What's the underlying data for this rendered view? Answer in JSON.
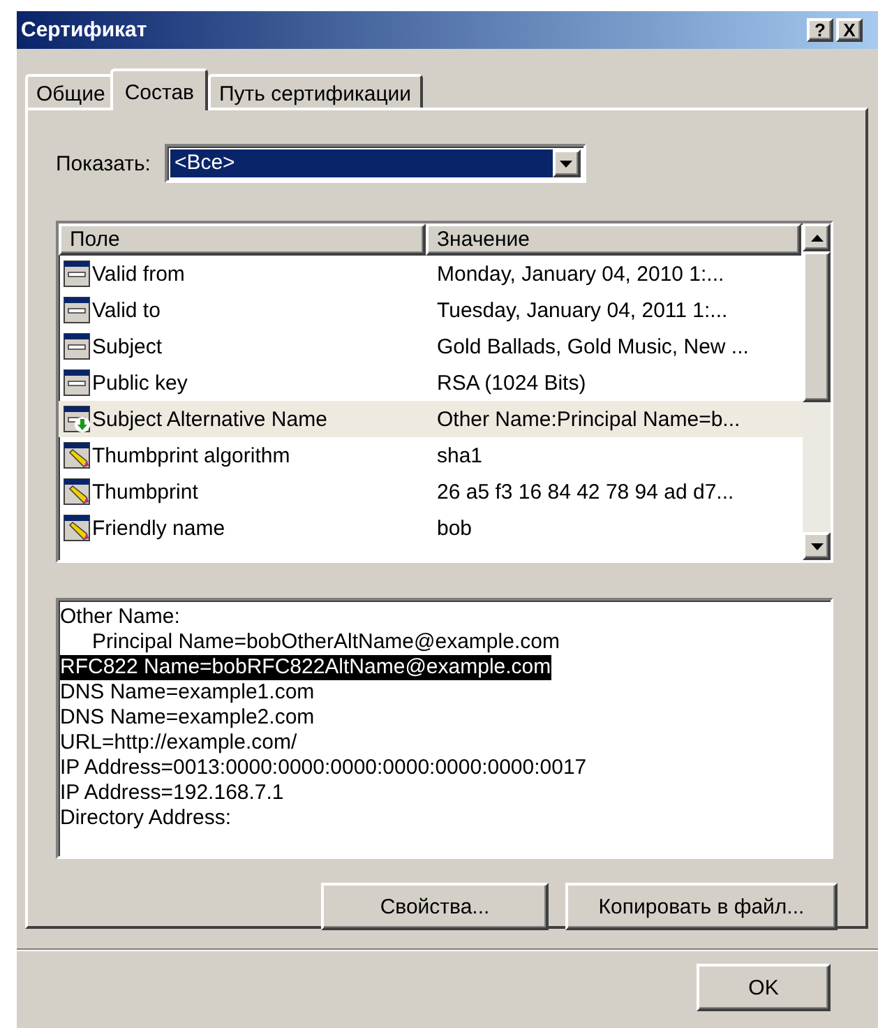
{
  "window": {
    "title": "Сертификат",
    "title_buttons": [
      "?",
      "X"
    ]
  },
  "tabs": [
    {
      "label": "Общие",
      "selected": false
    },
    {
      "label": "Состав",
      "selected": true
    },
    {
      "label": "Путь сертификации",
      "selected": false
    }
  ],
  "show": {
    "label": "Показать:",
    "value": "<Все>"
  },
  "fields": {
    "columns": [
      "Поле",
      "Значение"
    ],
    "rows": [
      {
        "kind": "field",
        "name": "Valid from",
        "value": "Monday, January 04, 2010 1:...",
        "selected": false
      },
      {
        "kind": "field",
        "name": "Valid to",
        "value": "Tuesday, January 04, 2011 1:...",
        "selected": false
      },
      {
        "kind": "field",
        "name": "Subject",
        "value": "Gold Ballads, Gold Music, New ...",
        "selected": false
      },
      {
        "kind": "field",
        "name": "Public key",
        "value": "RSA (1024 Bits)",
        "selected": false
      },
      {
        "kind": "extension",
        "name": "Subject Alternative Name",
        "value": "Other Name:Principal Name=b...",
        "selected": true
      },
      {
        "kind": "property",
        "name": "Thumbprint algorithm",
        "value": "sha1",
        "selected": false
      },
      {
        "kind": "property",
        "name": "Thumbprint",
        "value": "26 a5 f3 16 84 42 78 94 ad d7...",
        "selected": false
      },
      {
        "kind": "property",
        "name": "Friendly name",
        "value": "bob",
        "selected": false
      }
    ]
  },
  "details": [
    {
      "text": "Other Name:",
      "indented": false,
      "selected": false
    },
    {
      "text": "Principal Name=bobOtherAltName@example.com",
      "indented": true,
      "selected": false
    },
    {
      "text": "RFC822 Name=bobRFC822AltName@example.com",
      "indented": false,
      "selected": true
    },
    {
      "text": "DNS Name=example1.com",
      "indented": false,
      "selected": false
    },
    {
      "text": "DNS Name=example2.com",
      "indented": false,
      "selected": false
    },
    {
      "text": "URL=http://example.com/",
      "indented": false,
      "selected": false
    },
    {
      "text": "IP Address=0013:0000:0000:0000:0000:0000:0000:0017",
      "indented": false,
      "selected": false
    },
    {
      "text": "IP Address=192.168.7.1",
      "indented": false,
      "selected": false
    },
    {
      "text": "Directory Address:",
      "indented": false,
      "selected": false
    }
  ],
  "buttons": [
    "Свойства...",
    "Копировать в файл..."
  ],
  "footer_buttons": [
    "OK"
  ]
}
